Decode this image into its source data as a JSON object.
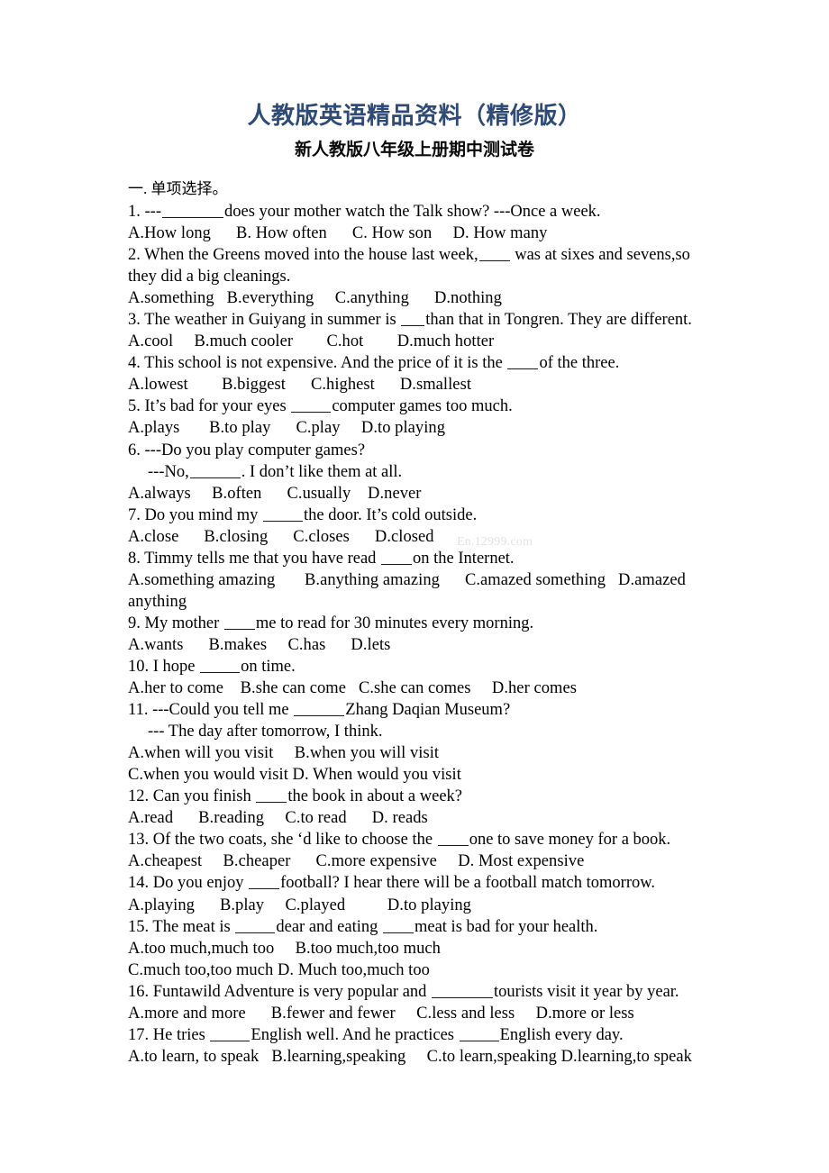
{
  "document": {
    "title": "人教版英语精品资料（精修版）",
    "subtitle": "新人教版八年级上册期中测试卷",
    "title_color": "#2e4a76",
    "subtitle_color": "#0a0a0a",
    "background_color": "#ffffff",
    "watermark": "En.12999.com",
    "watermark_color": "#e2e2e2"
  },
  "section": {
    "heading": "一. 单项选择。"
  },
  "questions": [
    {
      "stem_pre": "1. ---",
      "blank": "b-xl",
      "stem_post": "does your mother watch the Talk show? ---Once a week.",
      "options": "A.How long      B. How often      C. How son     D. How many"
    },
    {
      "stem_pre": "2. When the Greens moved into the house last week,",
      "blank": "b-s",
      "stem_post": " was at sixes and sevens,so they did a big cleanings.",
      "options": "A.something   B.everything     C.anything      D.nothing"
    },
    {
      "stem_pre": "3. The weather in Guiyang in summer is ",
      "blank": "b-xs",
      "stem_post": "than that in Tongren. They are different.",
      "options": "A.cool     B.much cooler        C.hot        D.much hotter"
    },
    {
      "stem_pre": "4. This school is not expensive. And the price of it is the ",
      "blank": "b-s",
      "stem_post": "of the three.",
      "options": "A.lowest        B.biggest      C.highest      D.smallest"
    },
    {
      "stem_pre": "5. It’s bad for your eyes ",
      "blank": "b-m",
      "stem_post": "computer games too much.",
      "options": "A.plays       B.to play      C.play     D.to playing"
    },
    {
      "stem_pre": "6. ---Do you play computer games?",
      "blank": "",
      "stem_post": "",
      "options": "A.always     B.often      C.usually    D.never",
      "extra_line_pre": "---No,",
      "extra_line_blank": "b-l",
      "extra_line_post": ". I don’t like them at all."
    },
    {
      "stem_pre": "7. Do you mind my ",
      "blank": "b-m",
      "stem_post": "the door. It’s cold outside.",
      "options": "A.close      B.closing      C.closes      D.closed"
    },
    {
      "stem_pre": "8. Timmy tells me that you have read ",
      "blank": "b-s",
      "stem_post": "on the Internet.",
      "options": "A.something amazing       B.anything amazing      C.amazed something   D.amazed anything"
    },
    {
      "stem_pre": "9. My mother ",
      "blank": "b-s",
      "stem_post": "me to read for 30 minutes every morning.",
      "options": "A.wants      B.makes     C.has      D.lets"
    },
    {
      "stem_pre": "10. I hope ",
      "blank": "b-m",
      "stem_post": "on time.",
      "options": "A.her to come    B.she can come   C.she can comes     D.her comes"
    },
    {
      "stem_pre": "11. ---Could you tell me ",
      "blank": "b-l",
      "stem_post": "Zhang Daqian Museum?",
      "options": "A.when will you visit     B.when you will visit",
      "options2": "C.when you would visit D. When would you visit",
      "extra_line_pre": "--- The day after tomorrow, I think.",
      "extra_line_blank": "",
      "extra_line_post": ""
    },
    {
      "stem_pre": "12. Can you finish ",
      "blank": "b-s",
      "stem_post": "the book in about a week?",
      "options": "A.read      B.reading     C.to read      D. reads"
    },
    {
      "stem_pre": "13. Of the two coats, she ‘d like to choose the ",
      "blank": "b-s",
      "stem_post": "one to save money for a book.",
      "options": "A.cheapest     B.cheaper      C.more expensive     D. Most expensive"
    },
    {
      "stem_pre": "14. Do you enjoy ",
      "blank": "b-s",
      "stem_post": "football? I hear there will be a football match tomorrow.",
      "options": "A.playing      B.play     C.played          D.to playing"
    },
    {
      "stem_pre": "15. The meat is ",
      "blank": "b-m",
      "stem_post": "dear and eating ",
      "blank2": "b-s",
      "stem_post2": "meat is bad for your health.",
      "options": "A.too much,much too     B.too much,too much",
      "options2": "C.much too,too much D. Much too,much too"
    },
    {
      "stem_pre": "16. Funtawild Adventure is very popular and ",
      "blank": "b-xl",
      "stem_post": "tourists visit it year by year.",
      "options": "A.more and more      B.fewer and fewer     C.less and less     D.more or less"
    },
    {
      "stem_pre": "17. He tries ",
      "blank": "b-m",
      "stem_post": "English well. And he practices ",
      "blank2": "b-m",
      "stem_post2": "English every day.",
      "options": "A.to learn, to speak   B.learning,speaking     C.to learn,speaking D.learning,to speak"
    }
  ]
}
